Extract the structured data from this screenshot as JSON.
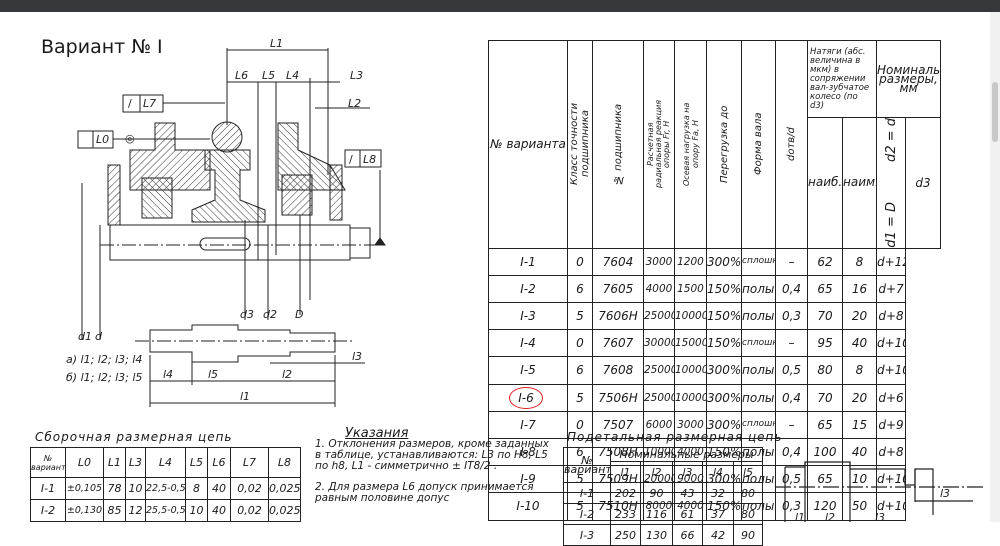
{
  "title": "Вариант № I",
  "drawing": {
    "labels": {
      "L1": "L1",
      "L2": "L2",
      "L3": "L3",
      "L4": "L4",
      "L5": "L5",
      "L6": "L6",
      "L7": "L7",
      "L8": "L8",
      "L0": "L0",
      "d1": "d1",
      "d": "d",
      "d3": "d3",
      "d2": "d2",
      "D": "D",
      "l1": "l1",
      "l2": "l2",
      "l3": "l3",
      "l4": "l4",
      "l5": "l5"
    },
    "option_a": "а) l1; l2; l3; l4",
    "option_b": "б) l1; l2; l3; l5"
  },
  "main_table": {
    "headers": {
      "variant": "№ варианта",
      "accuracy": "Класс точности подшипника",
      "bearing": "№ подшипника",
      "radial": "Расчетная радиальная реакция опоры Fr, Н",
      "axial": "Осевая нагрузка на опору Fa, Н",
      "overload": "Перегрузка до",
      "shaft": "Форма вала",
      "ratio": "dотв/d",
      "interference": "Натяги (абс. величина в мкм) в сопряжении вал-зубчатое колесо (по d3)",
      "max": "наиб.",
      "min": "наим.",
      "nominal": "Номинальные размеры, мм",
      "d3": "d3"
    },
    "merged": {
      "d2": "d2 = d",
      "d1": "d1 = D"
    },
    "rows": [
      [
        "I-1",
        "0",
        "7604",
        "3000",
        "1200",
        "300%",
        "сплошной",
        "–",
        "62",
        "8",
        "d+12"
      ],
      [
        "I-2",
        "6",
        "7605",
        "4000",
        "1500",
        "150%",
        "полый",
        "0,4",
        "65",
        "16",
        "d+7"
      ],
      [
        "I-3",
        "5",
        "7606H",
        "25000",
        "10000",
        "150%",
        "полый",
        "0,3",
        "70",
        "20",
        "d+8"
      ],
      [
        "I-4",
        "0",
        "7607",
        "30000",
        "15000",
        "150%",
        "сплошной",
        "–",
        "95",
        "40",
        "d+10"
      ],
      [
        "I-5",
        "6",
        "7608",
        "25000",
        "10000",
        "300%",
        "полый",
        "0,5",
        "80",
        "8",
        "d+10"
      ],
      [
        "I-6",
        "5",
        "7506H",
        "25000",
        "10000",
        "300%",
        "полый",
        "0,4",
        "70",
        "20",
        "d+6"
      ],
      [
        "I-7",
        "0",
        "7507",
        "6000",
        "3000",
        "300%",
        "сплошной",
        "–",
        "65",
        "15",
        "d+9"
      ],
      [
        "I-8",
        "6",
        "7508H",
        "10000",
        "4000",
        "150%",
        "полый",
        "0,4",
        "100",
        "40",
        "d+8"
      ],
      [
        "I-9",
        "5",
        "7509H",
        "20000",
        "9000",
        "300%",
        "полый",
        "0,5",
        "65",
        "10",
        "d+10"
      ],
      [
        "I-10",
        "5",
        "7510H",
        "8000",
        "4000",
        "150%",
        "полый",
        "0,3",
        "120",
        "50",
        "d+10"
      ]
    ],
    "highlight_color": "#e02020"
  },
  "assembly": {
    "title": "Сборочная размерная цепь",
    "headers": [
      "№ варианта",
      "L0",
      "L1",
      "L3",
      "L4",
      "L5",
      "L6",
      "L7",
      "L8"
    ],
    "rows": [
      [
        "I-1",
        "±0,105",
        "78",
        "10",
        "22,5-0,5",
        "8",
        "40",
        "0,02",
        "0,025"
      ],
      [
        "I-2",
        "±0,130",
        "85",
        "12",
        "25,5-0,5",
        "10",
        "40",
        "0,02",
        "0,025"
      ]
    ]
  },
  "notes": {
    "title": "Указания",
    "item1": "1. Отклонения размеров, кроме заданных в таблице, устанавливаются: L3 по H8, L5 по h8, L1 - симметрично ± IT8/2 .",
    "item2": "2. Для размера L6 допуск принимается равным половине допус"
  },
  "detail": {
    "title": "Подетальная размерная цепь",
    "variant_header": "№ варианта",
    "nominal_header": "Номинальные размеры",
    "headers": [
      "l1",
      "l2",
      "l3",
      "l4",
      "l5"
    ],
    "rows": [
      [
        "I-1",
        "202",
        "90",
        "43",
        "32",
        "80"
      ],
      [
        "I-2",
        "233",
        "116",
        "61",
        "37",
        "80"
      ],
      [
        "I-3",
        "250",
        "130",
        "66",
        "42",
        "90"
      ]
    ]
  }
}
